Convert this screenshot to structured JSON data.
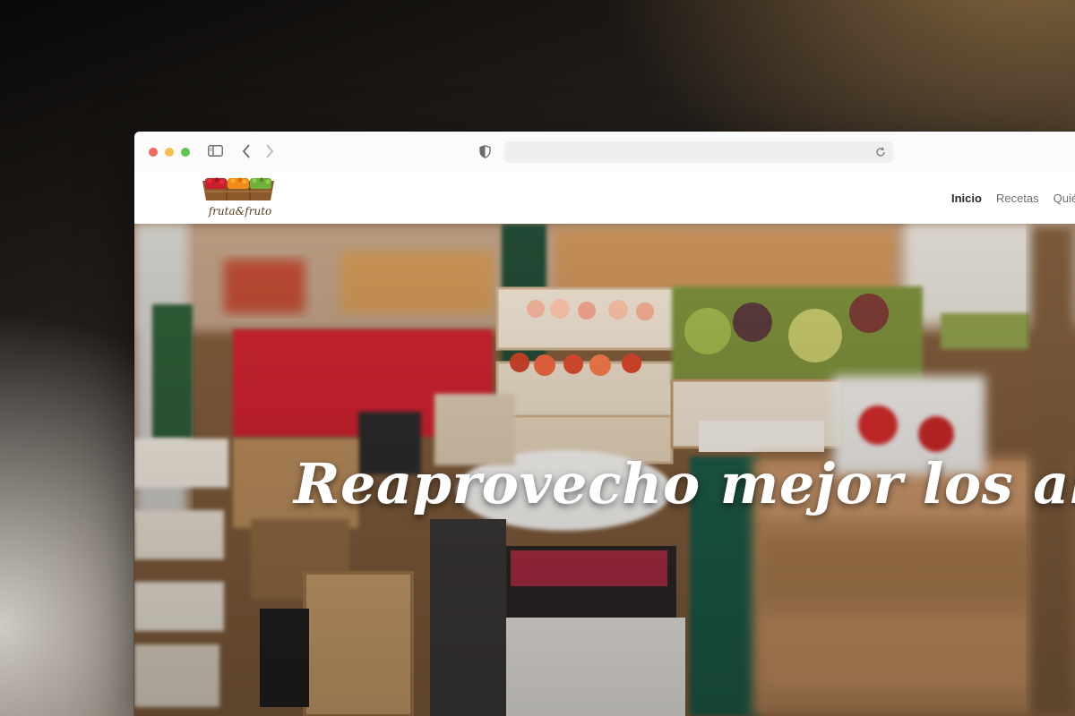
{
  "browser": {
    "icons": [
      "sidebar-icon",
      "back-icon",
      "forward-icon",
      "shield-icon",
      "reload-icon"
    ],
    "address_value": ""
  },
  "site": {
    "logo_text": "fruta&fruto",
    "nav": [
      {
        "label": "Inicio",
        "active": true
      },
      {
        "label": "Recetas",
        "active": false
      },
      {
        "label": "Quié",
        "active": false
      }
    ]
  },
  "hero": {
    "title": "Reaprovecho mejor los alimentos"
  },
  "colors": {
    "accent_text": "#2b2b2b",
    "nav_text": "#6f6f6f",
    "hero_text": "#ffffff"
  }
}
